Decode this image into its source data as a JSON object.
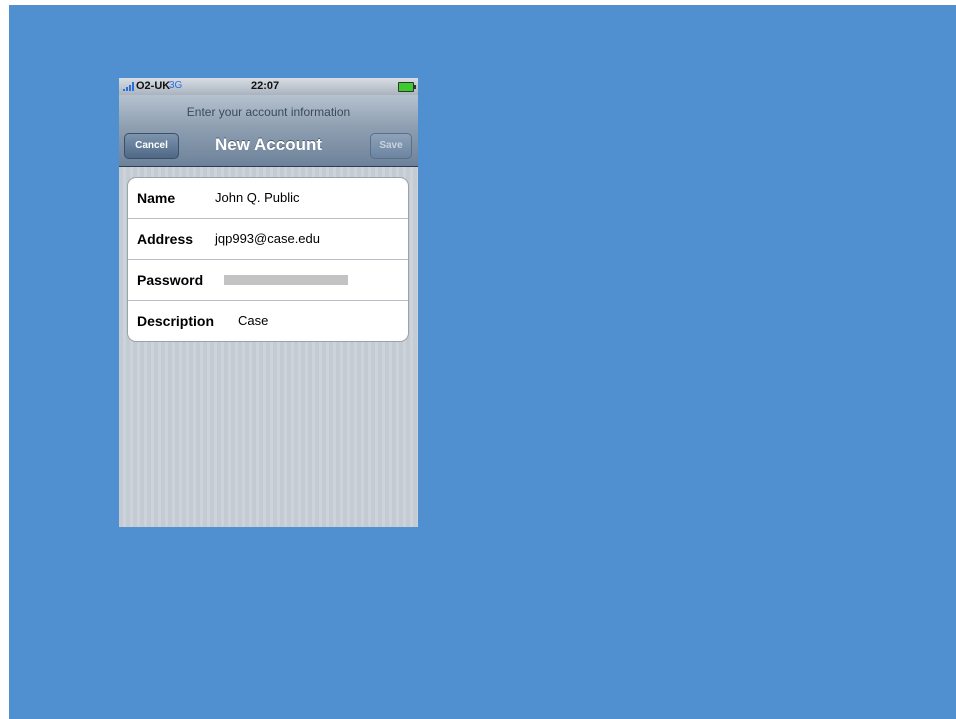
{
  "status": {
    "carrier": "O2-UK",
    "network": "3G",
    "time": "22:07",
    "battery_color": "#3ccc2e"
  },
  "nav": {
    "prompt": "Enter your account information",
    "title": "New Account",
    "cancel_label": "Cancel",
    "save_label": "Save"
  },
  "form": {
    "name_label": "Name",
    "name_value": "John Q. Public",
    "address_label": "Address",
    "address_value": "jqp993@case.edu",
    "password_label": "Password",
    "description_label": "Description",
    "description_value": "Case"
  },
  "colors": {
    "desktop_background": "#5090d0",
    "nav_gradient_top": "#b6c2cf",
    "nav_gradient_bottom": "#6d829a"
  }
}
